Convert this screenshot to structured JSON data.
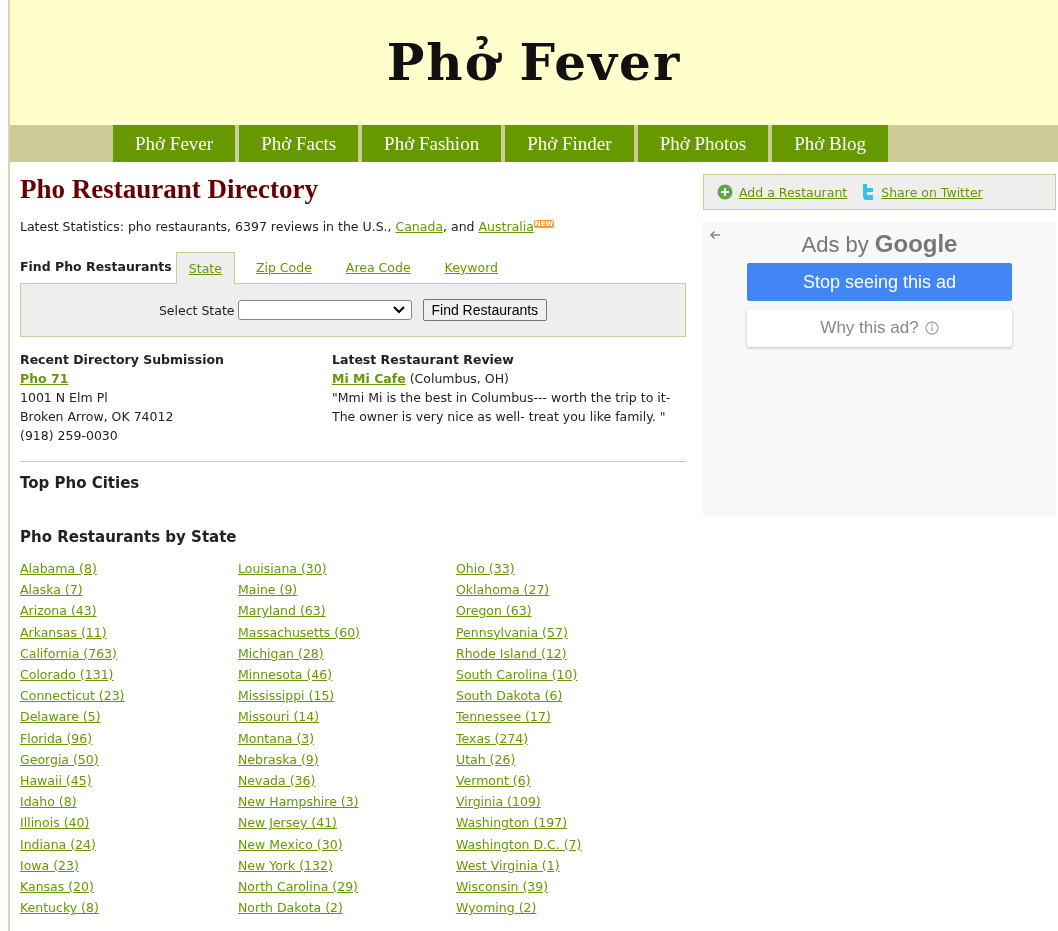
{
  "header": {
    "logo": "Phở Fever"
  },
  "nav": [
    "Phở Fever",
    "Phở Facts",
    "Phở Fashion",
    "Phở Finder",
    "Phở Photos",
    "Phở Blog"
  ],
  "main": {
    "title": "Pho Restaurant Directory",
    "stats": {
      "text": "Latest Statistics: pho restaurants, 6397 reviews in the U.S., ",
      "link_1": "Canada",
      "middle": ", and ",
      "link_2": "Australia",
      "badge": "NEW"
    },
    "search": {
      "label": "Find Pho Restaurants",
      "tabs": [
        {
          "label": "State",
          "selected": true
        },
        {
          "label": "Zip Code",
          "selected": false
        },
        {
          "label": "Area Code",
          "selected": false
        },
        {
          "label": "Keyword",
          "selected": false
        }
      ],
      "field_label": "Select State",
      "button": "Find Restaurants"
    },
    "submission": {
      "heading": "Recent Directory Submission",
      "name": "Pho 71",
      "lines": [
        "1001 N Elm Pl",
        "Broken Arrow, OK 74012",
        "(918) 259-0030"
      ]
    },
    "review": {
      "heading": "Latest Restaurant Review",
      "name": "Mi Mi Cafe",
      "location": " (Columbus, OH)",
      "quote": "\"Mmi Mi is the best in Columbus--- worth the trip to it- The owner is very nice as well- treat you like family. \""
    },
    "top_cities": {
      "heading": "Top Pho Cities"
    },
    "states": {
      "heading": "Pho Restaurants by State",
      "columns": [
        [
          "Alabama (8)",
          "Alaska (7)",
          "Arizona (43)",
          "Arkansas (11)",
          "California (763)",
          "Colorado (131)",
          "Connecticut (23)",
          "Delaware (5)",
          "Florida (96)",
          "Georgia (50)",
          "Hawaii (45)",
          "Idaho (8)",
          "Illinois (40)",
          "Indiana (24)",
          "Iowa (23)",
          "Kansas (20)",
          "Kentucky (8)"
        ],
        [
          "Louisiana (30)",
          "Maine (9)",
          "Maryland (63)",
          "Massachusetts (60)",
          "Michigan (28)",
          "Minnesota (46)",
          "Mississippi (15)",
          "Missouri (14)",
          "Montana (3)",
          "Nebraska (9)",
          "Nevada (36)",
          "New Hampshire (3)",
          "New Jersey (41)",
          "New Mexico (30)",
          "New York (132)",
          "North Carolina (29)",
          "North Dakota (2)"
        ],
        [
          "Ohio (33)",
          "Oklahoma (27)",
          "Oregon (63)",
          "Pennsylvania (57)",
          "Rhode Island (12)",
          "South Carolina (10)",
          "South Dakota (6)",
          "Tennessee (17)",
          "Texas (274)",
          "Utah (26)",
          "Vermont (6)",
          "Virginia (109)",
          "Washington (197)",
          "Washington D.C. (7)",
          "West Virginia (1)",
          "Wisconsin (39)",
          "Wyoming (2)"
        ]
      ]
    }
  },
  "sidebar": {
    "actions": [
      {
        "kind": "add",
        "label": "Add a Restaurant"
      },
      {
        "kind": "twitter",
        "label": "Share on Twitter"
      }
    ],
    "ad": {
      "ads_by": "Ads by",
      "brand": "Google",
      "stop_button": "Stop seeing this ad",
      "why_button": "Why this ad?"
    }
  }
}
